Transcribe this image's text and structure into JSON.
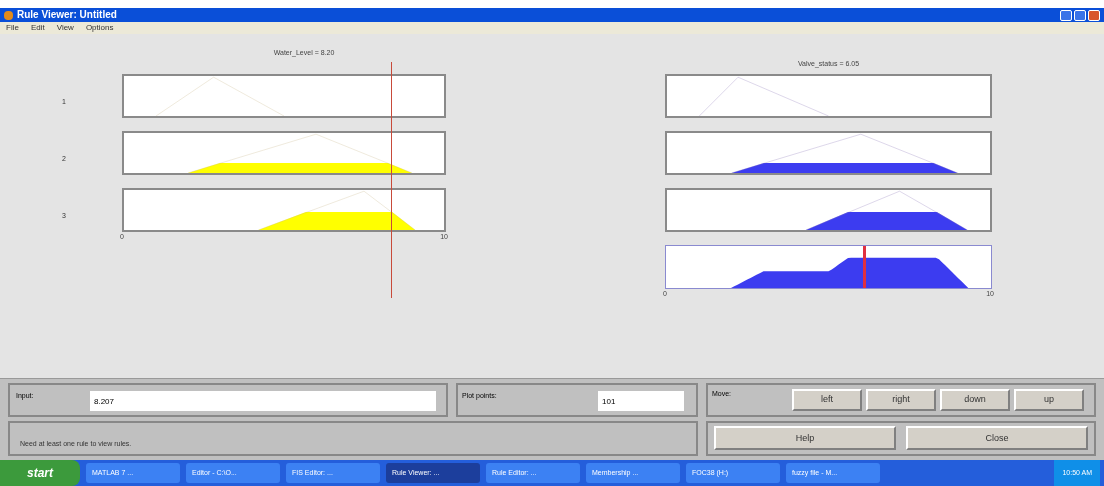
{
  "window": {
    "title": "Rule Viewer: Untitled"
  },
  "menu": [
    "File",
    "Edit",
    "View",
    "Options"
  ],
  "input_variable": {
    "title": "Water_Level = 8.20",
    "axis_min": "0",
    "axis_max": "10",
    "level": 0.83
  },
  "output_variable": {
    "title": "Valve_status = 6.05",
    "axis_min": "0",
    "axis_max": "10",
    "level": 0.605
  },
  "rules": [
    {
      "number": "1"
    },
    {
      "number": "2"
    },
    {
      "number": "3"
    }
  ],
  "input_field": {
    "label": "Input:",
    "value": "8.207"
  },
  "plot_points": {
    "label": "Plot points:",
    "value": "101"
  },
  "move": {
    "label": "Move:",
    "buttons": [
      "left",
      "right",
      "down",
      "up"
    ]
  },
  "message": "Need at least one rule to view rules.",
  "buttons": [
    "Help",
    "Close"
  ],
  "taskbar": {
    "start": "start",
    "items": [
      {
        "label": "MATLAB 7 ...",
        "selected": false
      },
      {
        "label": "Editor - C:\\O...",
        "selected": false
      },
      {
        "label": "FIS Editor: ...",
        "selected": false
      },
      {
        "label": "Rule Viewer: ...",
        "selected": true
      },
      {
        "label": "Rule Editor: ...",
        "selected": false
      },
      {
        "label": "Membership ...",
        "selected": false
      },
      {
        "label": "FOC38 (H:)",
        "selected": false
      },
      {
        "label": "fuzzy file - M...",
        "selected": false
      }
    ],
    "clock": "10:50 AM"
  }
}
